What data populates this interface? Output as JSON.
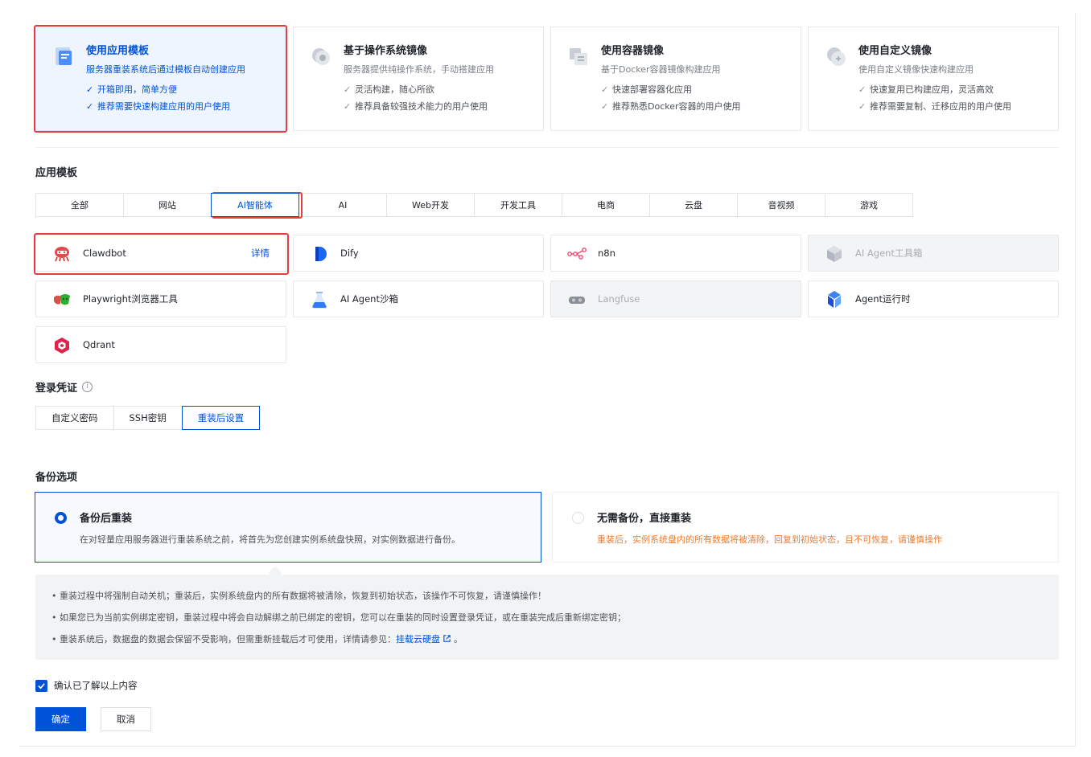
{
  "source_cards": [
    {
      "title": "使用应用模板",
      "desc": "服务器重装系统后通过模板自动创建应用",
      "features": [
        "开箱即用，简单方便",
        "推荐需要快速构建应用的用户使用"
      ],
      "selected": true,
      "icon": "app-template-icon"
    },
    {
      "title": "基于操作系统镜像",
      "desc": "服务器提供纯操作系统，手动搭建应用",
      "features": [
        "灵活构建，随心所欲",
        "推荐具备较强技术能力的用户使用"
      ],
      "selected": false,
      "icon": "os-image-icon"
    },
    {
      "title": "使用容器镜像",
      "desc": "基于Docker容器镜像构建应用",
      "features": [
        "快速部署容器化应用",
        "推荐熟悉Docker容器的用户使用"
      ],
      "selected": false,
      "icon": "container-image-icon"
    },
    {
      "title": "使用自定义镜像",
      "desc": "使用自定义镜像快速构建应用",
      "features": [
        "快速复用已构建应用，灵活高效",
        "推荐需要复制、迁移应用的用户使用"
      ],
      "selected": false,
      "icon": "custom-image-icon"
    }
  ],
  "templates_section": {
    "title": "应用模板",
    "tabs": [
      "全部",
      "网站",
      "AI智能体",
      "AI",
      "Web开发",
      "开发工具",
      "电商",
      "云盘",
      "音视频",
      "游戏"
    ],
    "active_tab": "AI智能体"
  },
  "templates": [
    {
      "name": "Clawdbot",
      "detail": "详情",
      "selected": true,
      "disabled": false,
      "icon": "clawdbot-icon"
    },
    {
      "name": "Dify",
      "selected": false,
      "disabled": false,
      "icon": "dify-icon"
    },
    {
      "name": "n8n",
      "selected": false,
      "disabled": false,
      "icon": "n8n-icon"
    },
    {
      "name": "AI Agent工具箱",
      "selected": false,
      "disabled": true,
      "icon": "cube-icon"
    },
    {
      "name": "Playwright浏览器工具",
      "selected": false,
      "disabled": false,
      "icon": "playwright-icon"
    },
    {
      "name": "AI Agent沙箱",
      "selected": false,
      "disabled": false,
      "icon": "flask-icon"
    },
    {
      "name": "Langfuse",
      "selected": false,
      "disabled": true,
      "icon": "langfuse-icon"
    },
    {
      "name": "Agent运行时",
      "selected": false,
      "disabled": false,
      "icon": "agent-runtime-icon"
    },
    {
      "name": "Qdrant",
      "selected": false,
      "disabled": false,
      "icon": "qdrant-icon"
    }
  ],
  "login": {
    "title": "登录凭证",
    "tabs": [
      "自定义密码",
      "SSH密钥",
      "重装后设置"
    ],
    "active_tab": "重装后设置"
  },
  "backup": {
    "title": "备份选项",
    "options": [
      {
        "title": "备份后重装",
        "desc": "在对轻量应用服务器进行重装系统之前，将首先为您创建实例系统盘快照，对实例数据进行备份。",
        "selected": true
      },
      {
        "title": "无需备份，直接重装",
        "desc": "重装后，实例系统盘内的所有数据将被清除，回复到初始状态，且不可恢复，请谨慎操作",
        "selected": false
      }
    ]
  },
  "notice": {
    "line1": "重装过程中将强制自动关机；重装后，实例系统盘内的所有数据将被清除，恢复到初始状态，该操作不可恢复，请谨慎操作！",
    "line2": "如果您已为当前实例绑定密钥，重装过程中将会自动解绑之前已绑定的密钥，您可以在重装的同时设置登录凭证，或在重装完成后重新绑定密钥；",
    "line3_prefix": "重装系统后，数据盘的数据会保留不受影响，但需重新挂载后才可使用，详情请参见：",
    "line3_link": "挂载云硬盘",
    "line3_suffix": "。"
  },
  "confirm": {
    "label": "确认已了解以上内容",
    "checked": true
  },
  "buttons": {
    "ok": "确定",
    "cancel": "取消"
  },
  "colors": {
    "primary": "#0052d9",
    "highlight": "#e63e3e",
    "warning": "#ed7b2f"
  }
}
